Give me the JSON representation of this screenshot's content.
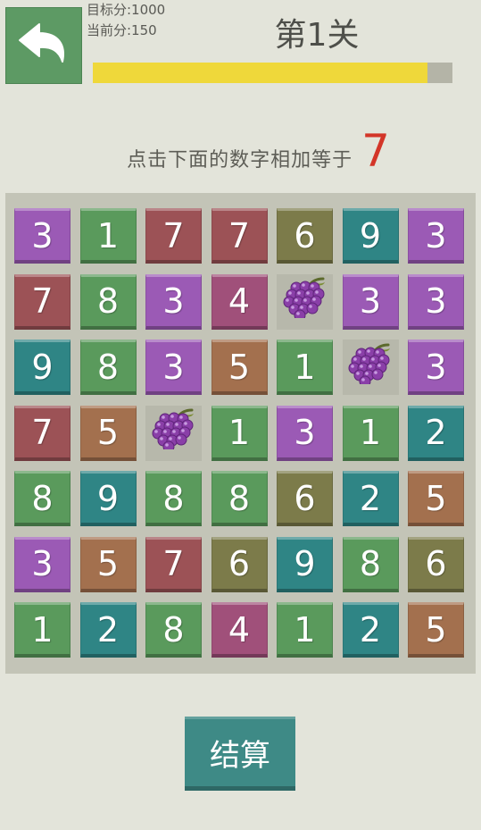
{
  "header": {
    "target_score": "目标分:1000",
    "current_score": "当前分:150",
    "level_title": "第1关",
    "progress": 0.93,
    "progress_color": "#efd83a"
  },
  "instruction": {
    "text": "点击下面的数字相加等于",
    "target": "7",
    "target_color": "#d33528"
  },
  "colors": {
    "purple": "#9b5ab5",
    "green": "#5a9a5c",
    "red": "#9c5256",
    "olive": "#7c7b4a",
    "teal": "#2f8585",
    "magenta": "#a0507a",
    "brown": "#a3704e",
    "grape_bg": "#b7b8ab"
  },
  "board": {
    "rows": [
      [
        {
          "v": "3",
          "c": "purple"
        },
        {
          "v": "1",
          "c": "green"
        },
        {
          "v": "7",
          "c": "red"
        },
        {
          "v": "7",
          "c": "red"
        },
        {
          "v": "6",
          "c": "olive"
        },
        {
          "v": "9",
          "c": "teal"
        },
        {
          "v": "3",
          "c": "purple"
        }
      ],
      [
        {
          "v": "7",
          "c": "red"
        },
        {
          "v": "8",
          "c": "green"
        },
        {
          "v": "3",
          "c": "purple"
        },
        {
          "v": "4",
          "c": "magenta"
        },
        {
          "v": "",
          "c": "grape_bg",
          "icon": "grape-icon"
        },
        {
          "v": "3",
          "c": "purple"
        },
        {
          "v": "3",
          "c": "purple"
        }
      ],
      [
        {
          "v": "9",
          "c": "teal"
        },
        {
          "v": "8",
          "c": "green"
        },
        {
          "v": "3",
          "c": "purple"
        },
        {
          "v": "5",
          "c": "brown"
        },
        {
          "v": "1",
          "c": "green"
        },
        {
          "v": "",
          "c": "grape_bg",
          "icon": "grape-icon"
        },
        {
          "v": "3",
          "c": "purple"
        }
      ],
      [
        {
          "v": "7",
          "c": "red"
        },
        {
          "v": "5",
          "c": "brown"
        },
        {
          "v": "",
          "c": "grape_bg",
          "icon": "grape-icon"
        },
        {
          "v": "1",
          "c": "green"
        },
        {
          "v": "3",
          "c": "purple"
        },
        {
          "v": "1",
          "c": "green"
        },
        {
          "v": "2",
          "c": "teal"
        }
      ],
      [
        {
          "v": "8",
          "c": "green"
        },
        {
          "v": "9",
          "c": "teal"
        },
        {
          "v": "8",
          "c": "green"
        },
        {
          "v": "8",
          "c": "green"
        },
        {
          "v": "6",
          "c": "olive"
        },
        {
          "v": "2",
          "c": "teal"
        },
        {
          "v": "5",
          "c": "brown"
        }
      ],
      [
        {
          "v": "3",
          "c": "purple"
        },
        {
          "v": "5",
          "c": "brown"
        },
        {
          "v": "7",
          "c": "red"
        },
        {
          "v": "6",
          "c": "olive"
        },
        {
          "v": "9",
          "c": "teal"
        },
        {
          "v": "8",
          "c": "green"
        },
        {
          "v": "6",
          "c": "olive"
        }
      ],
      [
        {
          "v": "1",
          "c": "green"
        },
        {
          "v": "2",
          "c": "teal"
        },
        {
          "v": "8",
          "c": "green"
        },
        {
          "v": "4",
          "c": "magenta"
        },
        {
          "v": "1",
          "c": "green"
        },
        {
          "v": "2",
          "c": "teal"
        },
        {
          "v": "5",
          "c": "brown"
        }
      ]
    ]
  },
  "submit": {
    "label": "结算"
  }
}
